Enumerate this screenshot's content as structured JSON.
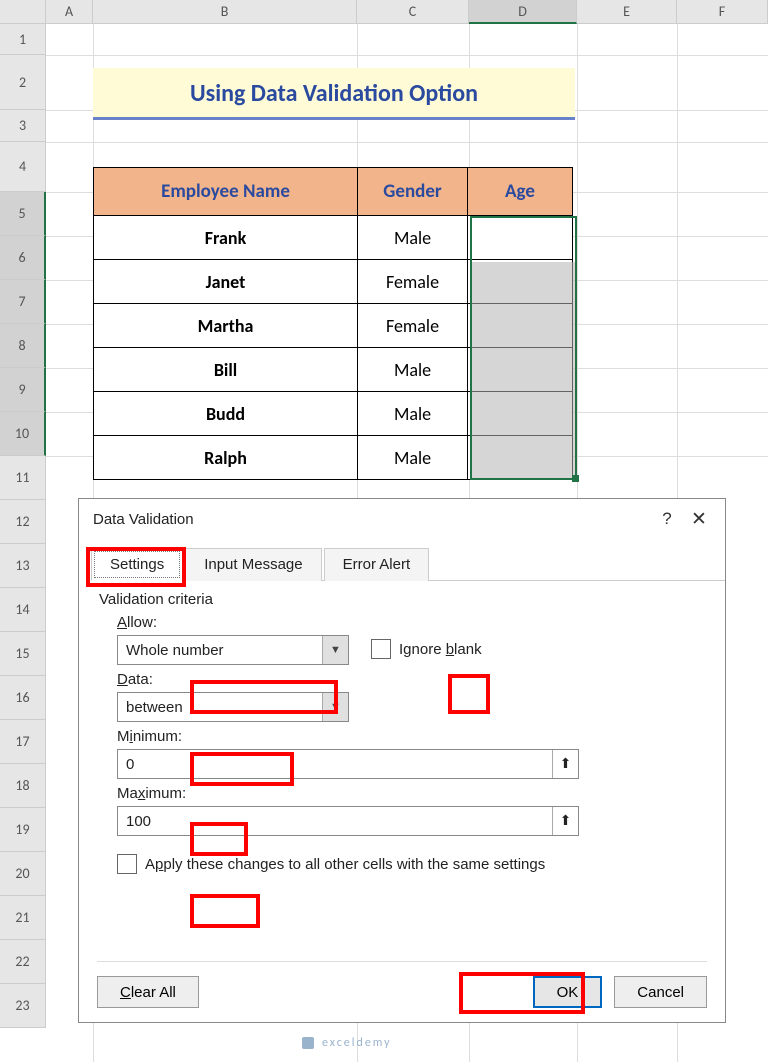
{
  "title": "Using Data Validation Option",
  "columns": [
    "A",
    "B",
    "C",
    "D",
    "E",
    "F"
  ],
  "rows": [
    "1",
    "2",
    "3",
    "4",
    "5",
    "6",
    "7",
    "8",
    "9",
    "10",
    "11",
    "12",
    "13",
    "14",
    "15",
    "16",
    "17",
    "18",
    "19",
    "20",
    "21",
    "22",
    "23"
  ],
  "table": {
    "headers": {
      "name": "Employee Name",
      "gender": "Gender",
      "age": "Age"
    },
    "data": [
      {
        "name": "Frank",
        "gender": "Male"
      },
      {
        "name": "Janet",
        "gender": "Female"
      },
      {
        "name": "Martha",
        "gender": "Female"
      },
      {
        "name": "Bill",
        "gender": "Male"
      },
      {
        "name": "Budd",
        "gender": "Male"
      },
      {
        "name": "Ralph",
        "gender": "Male"
      }
    ]
  },
  "dialog": {
    "title": "Data Validation",
    "tabs": {
      "settings": "Settings",
      "input": "Input Message",
      "error": "Error Alert"
    },
    "criteria_label": "Validation criteria",
    "allow_label": "Allow:",
    "allow_value": "Whole number",
    "ignore_blank": "Ignore blank",
    "data_label": "Data:",
    "data_value": "between",
    "min_label": "Minimum:",
    "min_value": "0",
    "max_label": "Maximum:",
    "max_value": "100",
    "apply_all": "Apply these changes to all other cells with the same settings",
    "clear_all": "Clear All",
    "ok": "OK",
    "cancel": "Cancel"
  },
  "watermark": "exceldemy"
}
